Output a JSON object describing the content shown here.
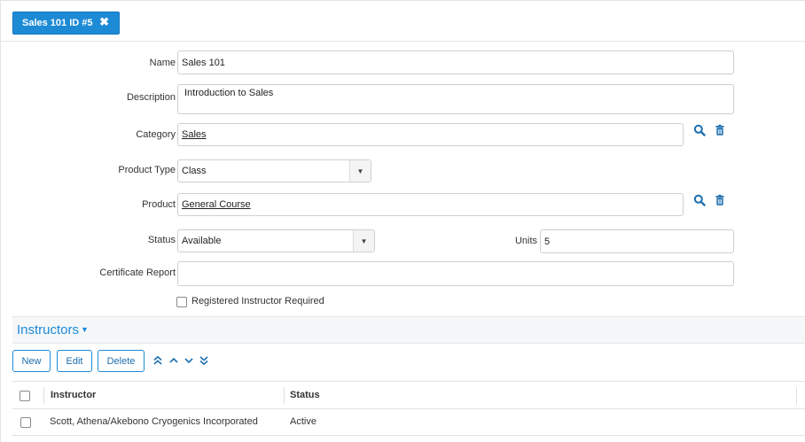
{
  "record_tab": {
    "label": "Sales 101 ID #5",
    "close_icon": "close-icon"
  },
  "form": {
    "name_label": "Name",
    "name_value": "Sales 101",
    "description_label": "Description",
    "description_value": "Introduction to Sales",
    "category_label": "Category",
    "category_value": "Sales",
    "product_type_label": "Product Type",
    "product_type_value": "Class",
    "product_label": "Product",
    "product_value": "General Course",
    "status_label": "Status",
    "status_value": "Available",
    "units_label": "Units",
    "units_value": "5",
    "certificate_label": "Certificate Report",
    "certificate_value": "",
    "registered_instructor_label": "Registered Instructor Required",
    "registered_instructor_checked": false
  },
  "instructors": {
    "title": "Instructors",
    "buttons": {
      "new": "New",
      "edit": "Edit",
      "delete": "Delete"
    },
    "columns": [
      "Instructor",
      "Status"
    ],
    "rows": [
      {
        "instructor": "Scott, Athena/Akebono Cryogenics Incorporated",
        "status": "Active"
      }
    ]
  },
  "colors": {
    "accent": "#1d8ad6",
    "border": "#cfcfcf",
    "section_bg": "#f5f7f9"
  }
}
